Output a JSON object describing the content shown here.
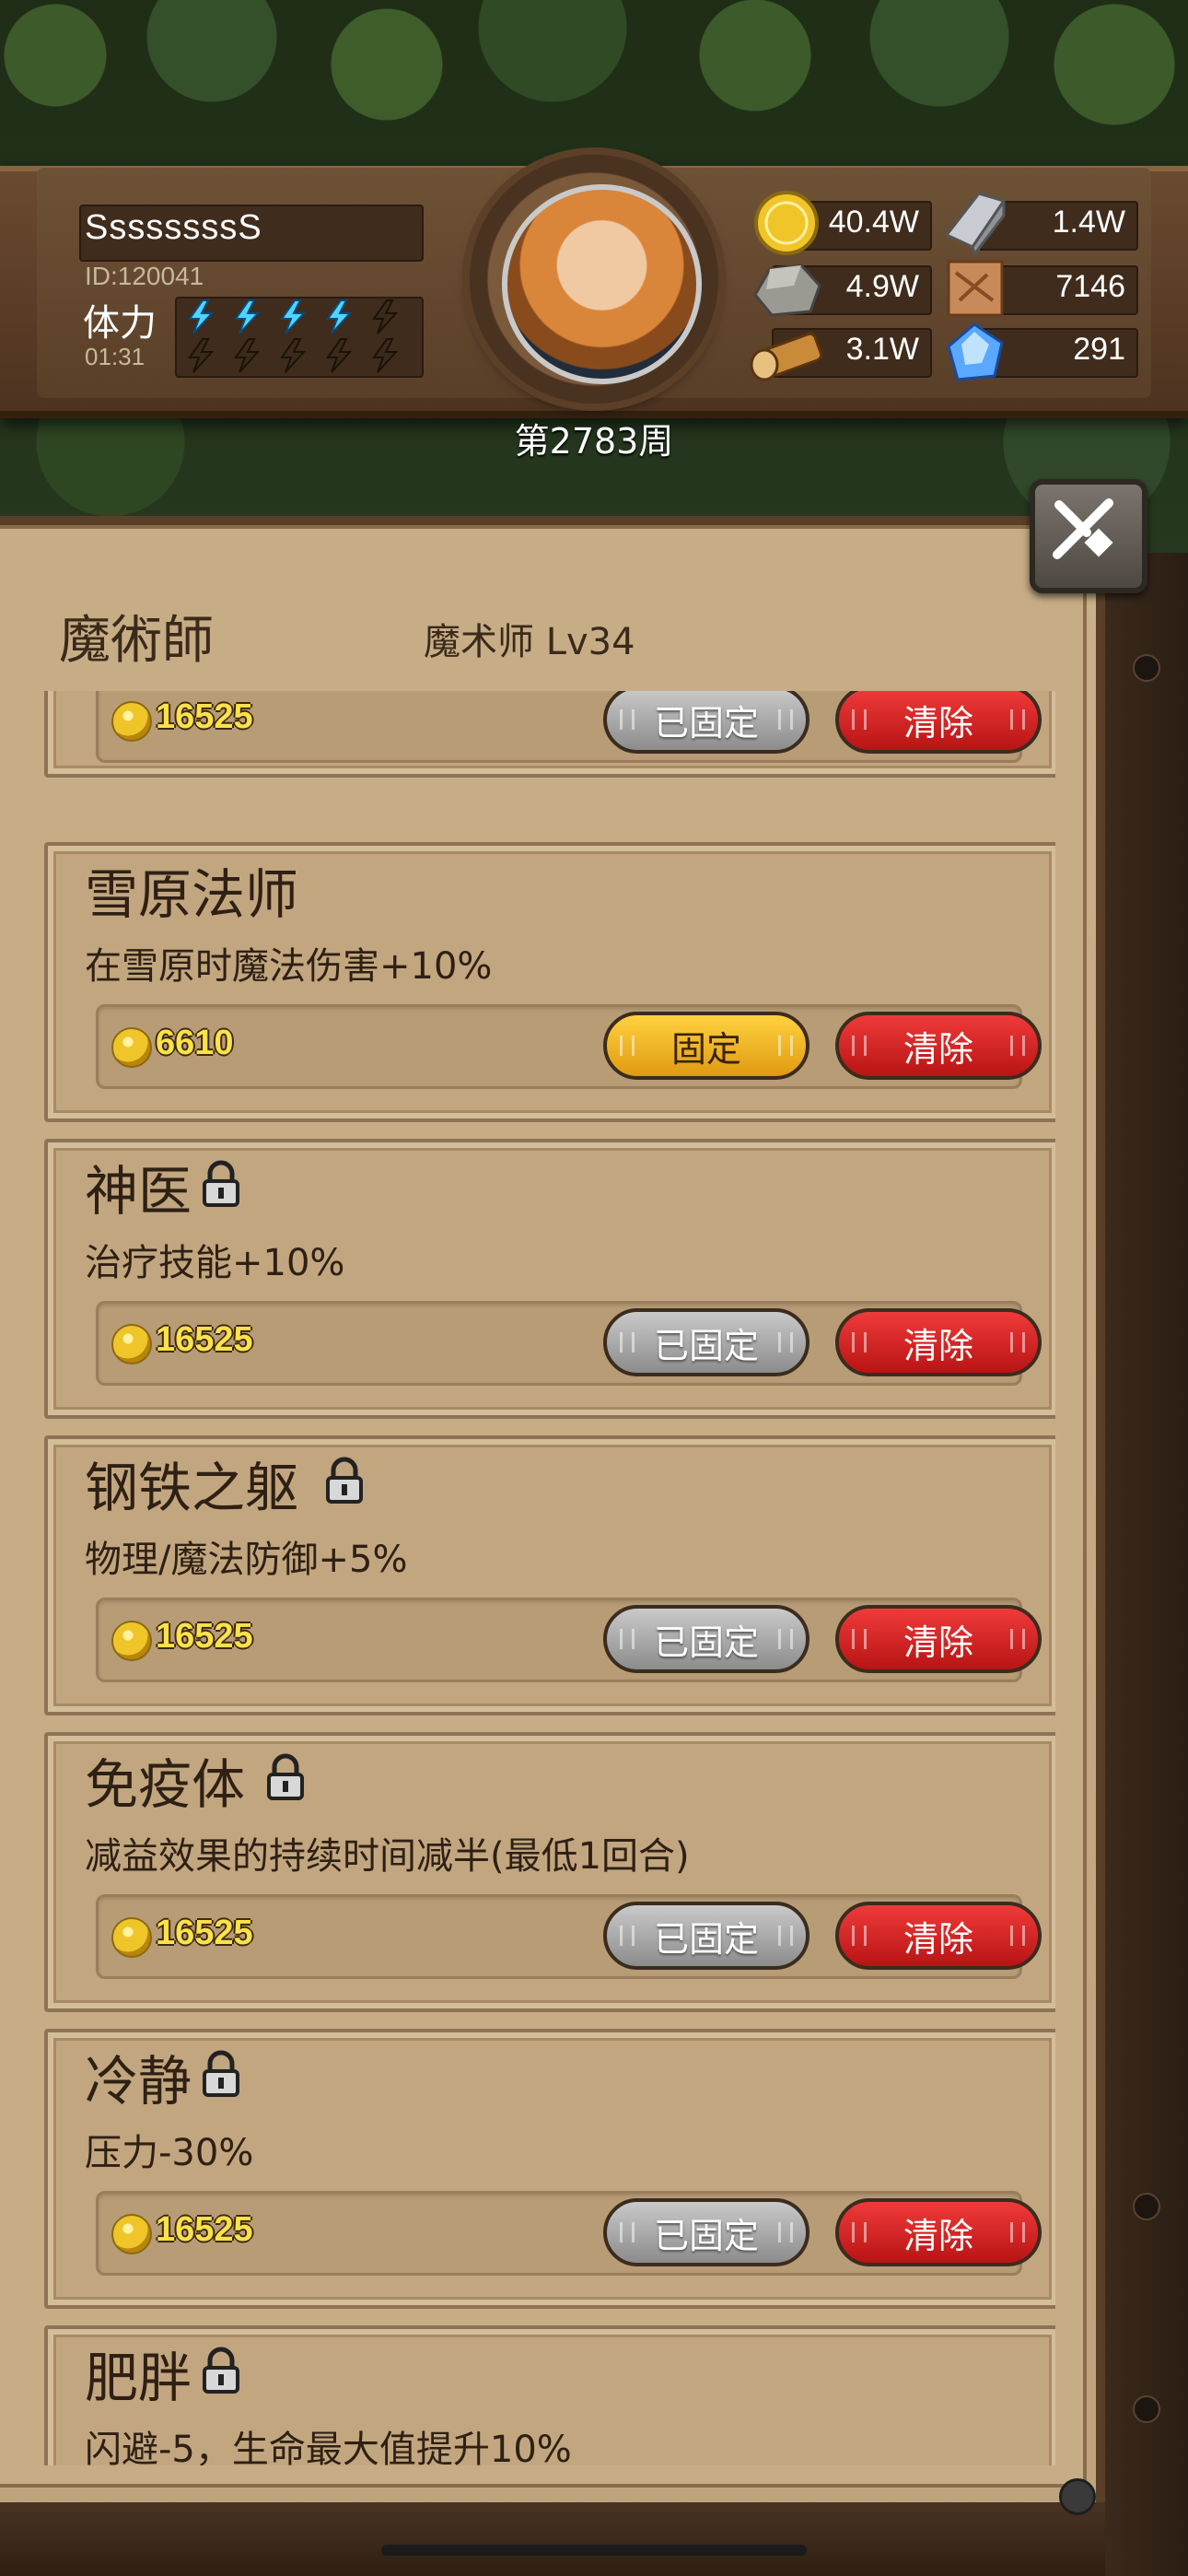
{
  "player": {
    "name": "SsssssssS",
    "id": "ID:120041",
    "stamina_label": "体力",
    "stamina_timer": "01:31",
    "stamina_filled": 4,
    "stamina_total": 5,
    "week": "第2783周"
  },
  "resources": [
    {
      "icon": "gold-coin-icon",
      "value": "40.4W"
    },
    {
      "icon": "iron-ingot-icon",
      "value": "1.4W"
    },
    {
      "icon": "stone-ore-icon",
      "value": "4.9W"
    },
    {
      "icon": "leather-scroll-icon",
      "value": "7146"
    },
    {
      "icon": "wood-log-icon",
      "value": "3.1W"
    },
    {
      "icon": "blue-crystal-icon",
      "value": "291"
    }
  ],
  "panel": {
    "title": "魔術師",
    "subtitle": "魔术师 Lv34"
  },
  "labels": {
    "fixed": "已固定",
    "fix": "固定",
    "clear": "清除"
  },
  "traits": [
    {
      "name": "",
      "desc": "",
      "cost": "16525",
      "locked": true,
      "partial_top": true
    },
    {
      "name": "雪原法师",
      "desc": "在雪原时魔法伤害+10%",
      "cost": "6610",
      "locked": false
    },
    {
      "name": "神医",
      "desc": "治疗技能+10%",
      "cost": "16525",
      "locked": true
    },
    {
      "name": "钢铁之躯",
      "desc": "物理/魔法防御+5%",
      "cost": "16525",
      "locked": true
    },
    {
      "name": "免疫体",
      "desc": "减益效果的持续时间减半(最低1回合)",
      "cost": "16525",
      "locked": true
    },
    {
      "name": "冷静",
      "desc": "压力-30%",
      "cost": "16525",
      "locked": true
    },
    {
      "name": "肥胖",
      "desc": "闪避-5，生命最大值提升10%",
      "cost": "",
      "locked": true
    }
  ],
  "colors": {
    "panel_bg": "#c7ad86",
    "btn_fixed": "#a9a9a9",
    "btn_fix": "#f2b526",
    "btn_clear": "#d62222",
    "cost_text": "#ffe14a"
  }
}
